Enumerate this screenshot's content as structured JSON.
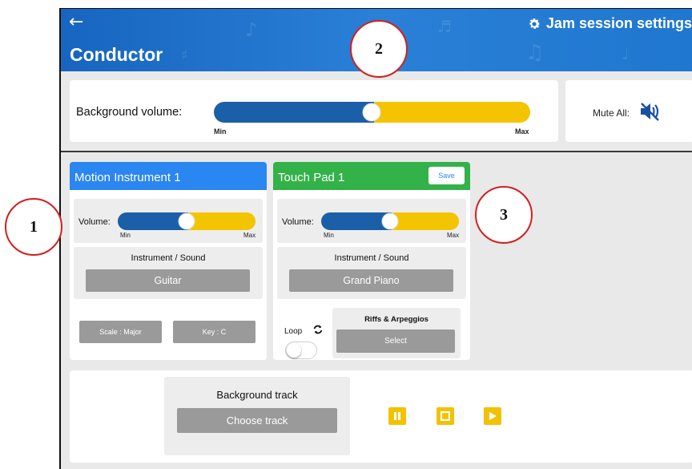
{
  "header": {
    "back_icon": "arrow-left-icon",
    "title": "Conductor",
    "settings_label": "Jam session settings",
    "settings_icon": "gear-icon",
    "background_color": "#1f71cc"
  },
  "annotations": {
    "one": "1",
    "two": "2",
    "three": "3"
  },
  "background_volume": {
    "label": "Background volume:",
    "min_label": "Min",
    "max_label": "Max",
    "level": 0.5
  },
  "mute": {
    "label": "Mute All:",
    "icon": "speaker-muted-icon"
  },
  "motion_instrument": {
    "title": "Motion Instrument 1",
    "header_color": "#2a86f0",
    "volume_label": "Volume:",
    "min_label": "Min",
    "max_label": "Max",
    "volume_level": 0.5,
    "sound_title": "Instrument / Sound",
    "sound_value": "Guitar",
    "scale_button": "Scale : Major",
    "key_button": "Key : C"
  },
  "touch_pad": {
    "title": "Touch Pad 1",
    "header_color": "#33b24a",
    "save_label": "Save",
    "volume_label": "Volume:",
    "min_label": "Min",
    "max_label": "Max",
    "volume_level": 0.5,
    "sound_title": "Instrument / Sound",
    "sound_value": "Grand Piano",
    "loop_label": "Loop",
    "loop_icon": "repeat-icon",
    "loop_on": false,
    "riffs_title": "Riffs & Arpeggios",
    "riffs_button": "Select"
  },
  "track": {
    "title": "Background track",
    "choose_button": "Choose track",
    "pause_icon": "pause-icon",
    "stop_icon": "stop-icon",
    "play_icon": "play-icon",
    "accent_color": "#f2c200"
  },
  "colors": {
    "slider_left": "#1a5fa8",
    "slider_right": "#f5c400",
    "button_gray": "#9a9a9a"
  }
}
